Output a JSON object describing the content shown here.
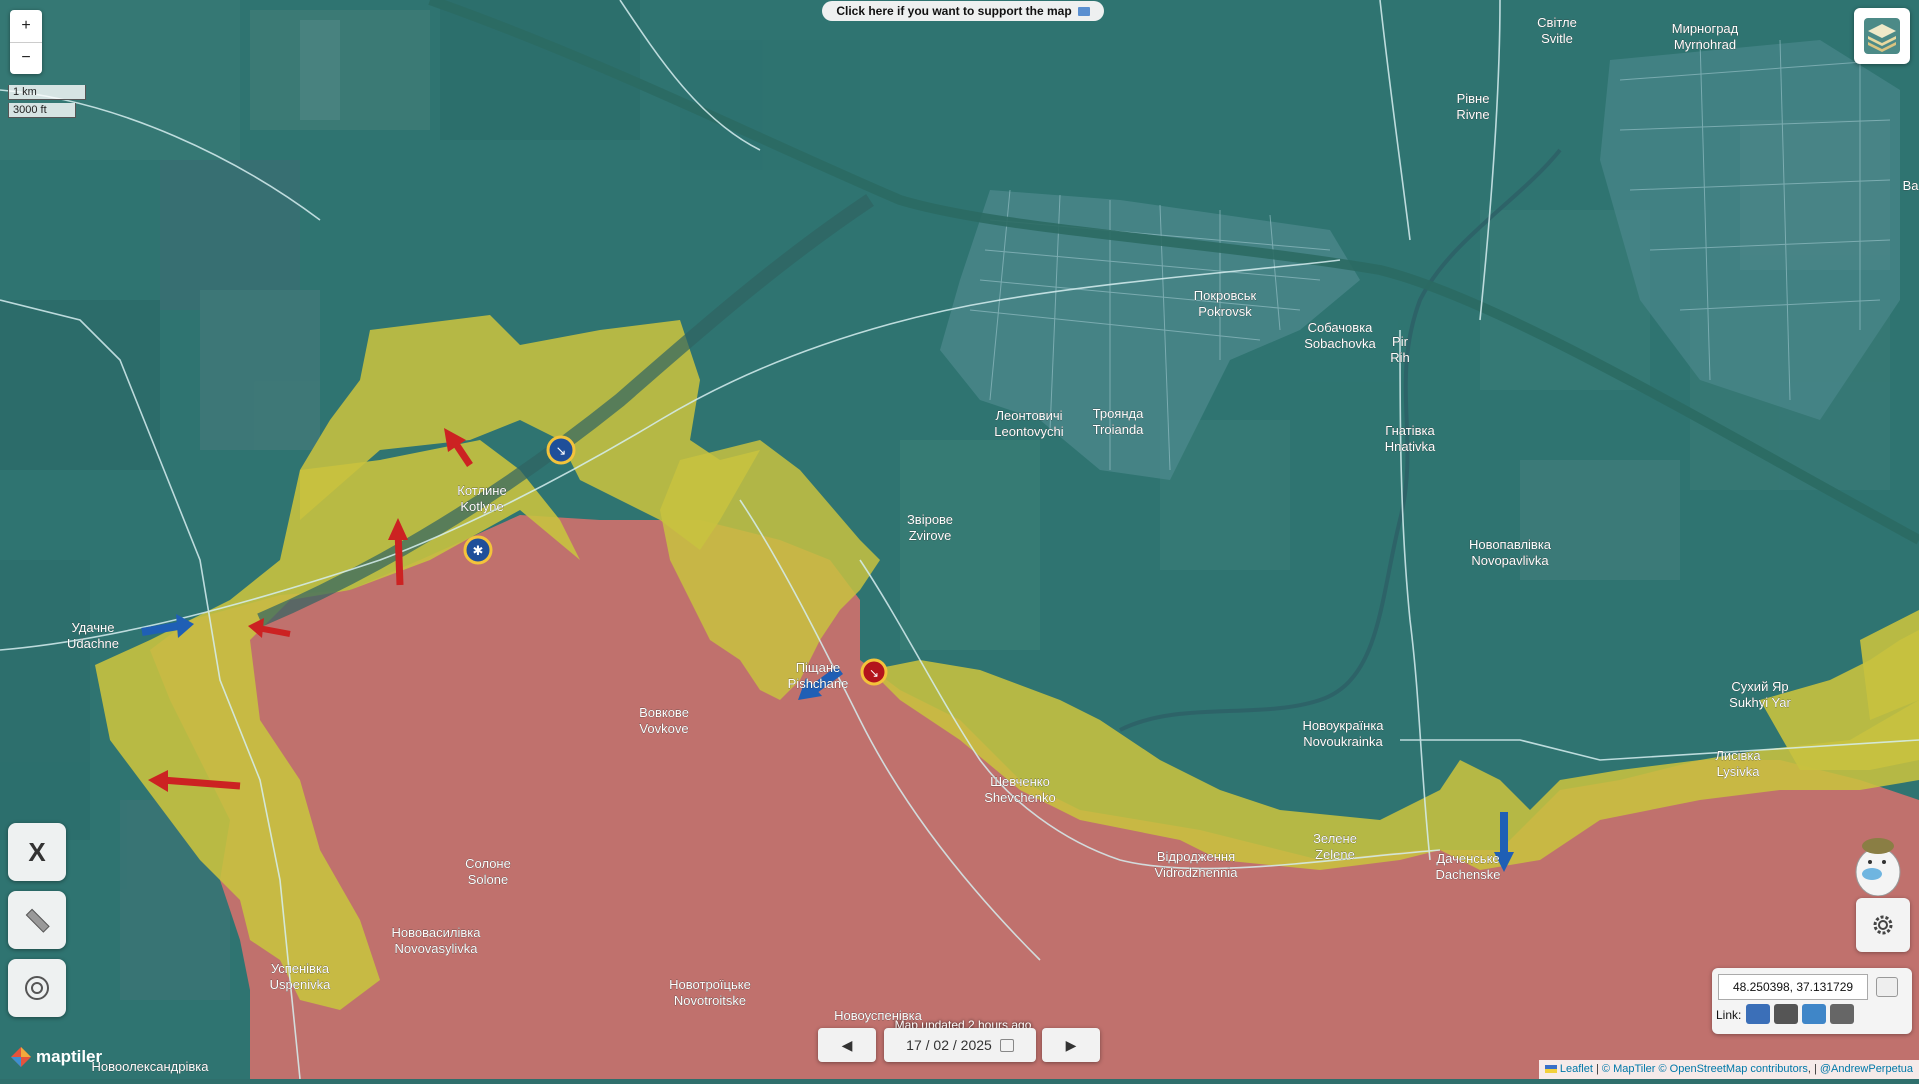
{
  "banner": {
    "text": "Click here if you want to support the map"
  },
  "zoom": {
    "in": "+",
    "out": "−"
  },
  "scale": {
    "metric": "1 km",
    "imperial": "3000 ft"
  },
  "colors": {
    "ukraine_control": "#2f7a7a",
    "russian_control": "#d9756f",
    "contested": "#c9c240",
    "attack_russian": "#cc2222",
    "attack_ukrainian": "#1f5fb5"
  },
  "places": [
    {
      "ua": "Покровськ",
      "en": "Pokrovsk"
    },
    {
      "ua": "Мирноград",
      "en": "Myrnohrad"
    },
    {
      "ua": "Світле",
      "en": "Svitle"
    },
    {
      "ua": "Рівне",
      "en": "Rivne"
    },
    {
      "ua": "Собачовка",
      "en": "Sobachovka"
    },
    {
      "ua": "Pir",
      "en": "Rih"
    },
    {
      "ua": "Леонтовичі",
      "en": "Leontovychi"
    },
    {
      "ua": "Троянда",
      "en": "Troianda"
    },
    {
      "ua": "Гнатівка",
      "en": "Hnativka"
    },
    {
      "ua": "Котлине",
      "en": "Kotlyne"
    },
    {
      "ua": "Звірове",
      "en": "Zvirove"
    },
    {
      "ua": "Новопавлівка",
      "en": "Novopavlivka"
    },
    {
      "ua": "Удачне",
      "en": "Udachne"
    },
    {
      "ua": "Піщане",
      "en": "Pishchane"
    },
    {
      "ua": "Вовкове",
      "en": "Vovkove"
    },
    {
      "ua": "Сухий Яр",
      "en": "Sukhyi Yar"
    },
    {
      "ua": "Новоукраїнка",
      "en": "Novoukrainka"
    },
    {
      "ua": "Шевченко",
      "en": "Shevchenko"
    },
    {
      "ua": "Лисівка",
      "en": "Lysivka"
    },
    {
      "ua": "Зелене",
      "en": "Zelene"
    },
    {
      "ua": "Даченське",
      "en": "Dachenske"
    },
    {
      "ua": "Відродження",
      "en": "Vidrodzhennia"
    },
    {
      "ua": "Солоне",
      "en": "Solone"
    },
    {
      "ua": "Нововасилівка",
      "en": "Novovasylivka"
    },
    {
      "ua": "Успенівка",
      "en": "Uspenivka"
    },
    {
      "ua": "Новотроїцьке",
      "en": "Novotroitske"
    },
    {
      "ua": "Новоолександрівка",
      "en": ""
    },
    {
      "ua": "Новоуспенівка",
      "en": ""
    },
    {
      "ua": "Бал",
      "en": "Bal"
    }
  ],
  "tools": {
    "x_icon": "X",
    "ruler_icon": "ruler-icon",
    "target_icon": "target-icon"
  },
  "timebar": {
    "updated": "Map updated 2 hours ago",
    "date": "17 / 02 / 2025",
    "prev": "◀",
    "next": "▶"
  },
  "coords": {
    "value": "48.250398, 37.131729",
    "link_label": "Link:"
  },
  "attribution": {
    "leaflet": "Leaflet",
    "maptiler": "© MapTiler",
    "osm": "© OpenStreetMap contributors",
    "author": "@AndrewPerpetua"
  },
  "logo": {
    "text": "maptiler"
  }
}
